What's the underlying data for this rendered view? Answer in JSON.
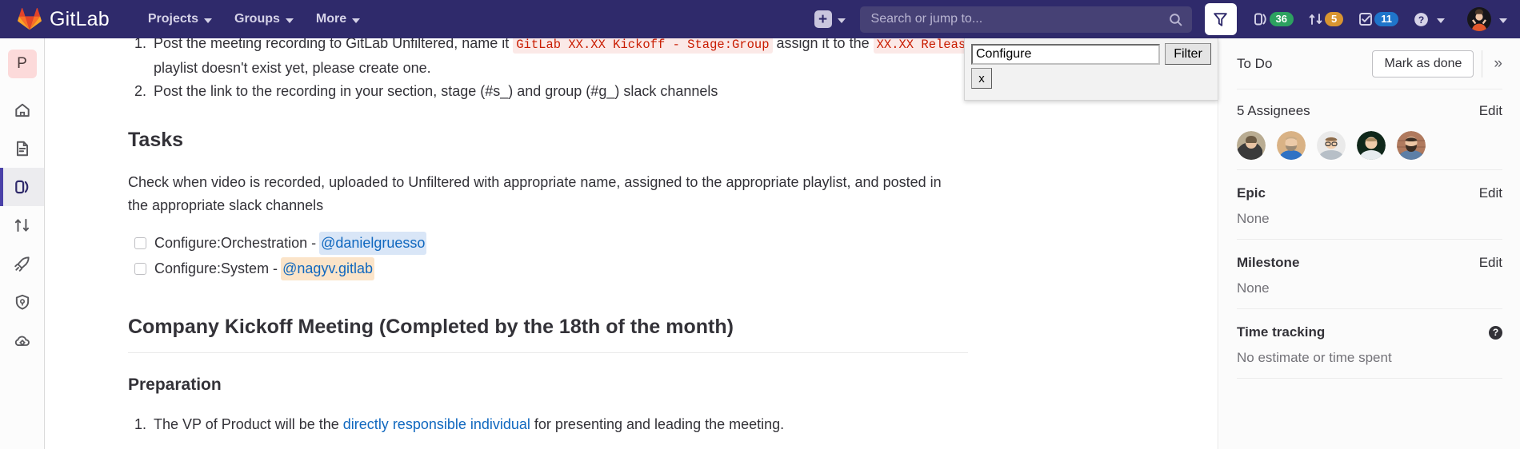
{
  "navbar": {
    "brand": "GitLab",
    "logo_icon": "gitlab-tanuki-logo",
    "links": [
      {
        "label": "Projects",
        "icon": "chevron-down-icon"
      },
      {
        "label": "Groups",
        "icon": "chevron-down-icon"
      },
      {
        "label": "More",
        "icon": "chevron-down-icon"
      }
    ],
    "create_new": {
      "icon": "plus-square-icon",
      "chevron": "chevron-down-icon"
    },
    "search": {
      "placeholder": "Search or jump to...",
      "icon": "search-icon"
    },
    "filter_button": {
      "icon": "filter-funnel-icon"
    },
    "counters": [
      {
        "icon": "issues-icon",
        "count": "36",
        "color": "#2da160"
      },
      {
        "icon": "merge-request-icon",
        "count": "5",
        "color": "#d99530"
      },
      {
        "icon": "todo-check-icon",
        "count": "11",
        "color": "#1f75cb"
      }
    ],
    "help": {
      "icon": "question-circle-icon",
      "chevron": "chevron-down-icon"
    },
    "user": {
      "icon": "user-avatar",
      "chevron": "chevron-down-icon"
    }
  },
  "left_sidebar": {
    "project_initial": "P",
    "items": [
      {
        "icon": "home-icon",
        "name": "project-overview",
        "active": false
      },
      {
        "icon": "document-icon",
        "name": "repository",
        "active": false
      },
      {
        "icon": "issues-icon",
        "name": "issues",
        "active": true
      },
      {
        "icon": "merge-request-icon",
        "name": "merge-requests",
        "active": false
      },
      {
        "icon": "rocket-icon",
        "name": "ci-cd",
        "active": false
      },
      {
        "icon": "shield-icon",
        "name": "security-compliance",
        "active": false
      },
      {
        "icon": "cloud-gear-icon",
        "name": "deployments",
        "active": false
      }
    ]
  },
  "find_bar": {
    "input_value": "Configure",
    "filter_label": "Filter",
    "close_label": "x"
  },
  "content": {
    "list_top": [
      {
        "num": "1.",
        "parts": [
          {
            "type": "text",
            "text": "Post the meeting recording to GitLab Unfiltered, name it "
          },
          {
            "type": "code",
            "text": "GitLab XX.XX Kickoff - Stage:Group"
          },
          {
            "type": "text",
            "text": " assign it to the "
          },
          {
            "type": "code",
            "text": "XX.XX Release Kickoff"
          },
          {
            "type": "text",
            "text": " YouTube playlist. If the playlist doesn't exist yet, please create one."
          }
        ]
      },
      {
        "num": "2.",
        "parts": [
          {
            "type": "text",
            "text": "Post the link to the recording in your section, stage (#s_) and group (#g_) slack channels"
          }
        ]
      }
    ],
    "tasks_heading": "Tasks",
    "tasks_paragraph": "Check when video is recorded, uploaded to Unfiltered with appropriate name, assigned to the appropriate playlist, and posted in the appropriate slack channels",
    "task_items": [
      {
        "label": "Configure:Orchestration - ",
        "mention": "@danielgruesso",
        "mention_style": "blue",
        "checked": false
      },
      {
        "label": "Configure:System - ",
        "mention": "@nagyv.gitlab",
        "mention_style": "tan",
        "checked": false
      }
    ],
    "section_heading": "Company Kickoff Meeting (Completed by the 18th of the month)",
    "prep_heading": "Preparation",
    "prep_items": [
      {
        "num": "1.",
        "parts": [
          {
            "type": "text",
            "text": "The VP of Product will be the "
          },
          {
            "type": "link",
            "text": "directly responsible individual"
          },
          {
            "type": "text",
            "text": " for presenting and leading the meeting."
          }
        ]
      }
    ]
  },
  "right_sidebar": {
    "todo": {
      "label": "To Do",
      "button": "Mark as done",
      "collapse_icon": "double-chevron-right-icon"
    },
    "assignees": {
      "title": "5 Assignees",
      "edit": "Edit",
      "count": 5
    },
    "epic": {
      "title": "Epic",
      "edit": "Edit",
      "value": "None"
    },
    "milestone": {
      "title": "Milestone",
      "edit": "Edit",
      "value": "None"
    },
    "time_tracking": {
      "title": "Time tracking",
      "value": "No estimate or time spent",
      "help_icon": "question-circle-icon"
    }
  }
}
